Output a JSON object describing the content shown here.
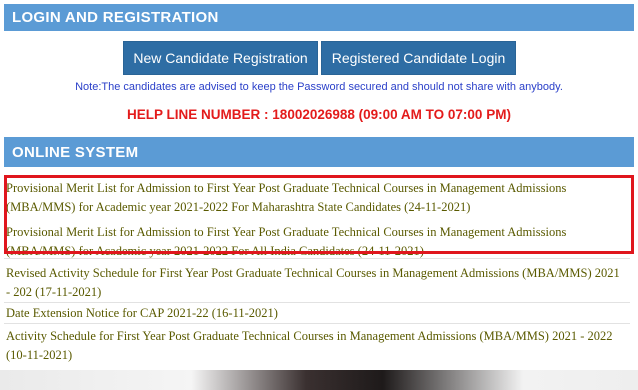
{
  "login_section": {
    "title": "LOGIN AND REGISTRATION",
    "new_registration_label": "New Candidate Registration",
    "registered_login_label": "Registered Candidate Login",
    "note": "Note:The candidates are advised to keep the Password secured and should not share with anybody.",
    "helpline": "HELP LINE NUMBER : 18002026988 (09:00 AM TO 07:00 PM)"
  },
  "online_system": {
    "title": "ONLINE SYSTEM",
    "notices": [
      "Provisional Merit List for Admission to First Year Post Graduate Technical Courses in Management Admissions (MBA/MMS) for Academic year 2021-2022 For Maharashtra State Candidates (24-11-2021)",
      "Provisional Merit List for Admission to First Year Post Graduate Technical Courses in Management Admissions (MBA/MMS) for Academic year 2021-2022 For All India Candidates (24-11-2021)",
      "Revised Activity Schedule for First Year Post Graduate Technical Courses in Management Admissions (MBA/MMS) 2021 - 202 (17-11-2021)",
      "Date Extension Notice for CAP 2021-22 (16-11-2021)",
      "Activity Schedule for First Year Post Graduate Technical Courses in Management Admissions (MBA/MMS) 2021 - 2022 (10-11-2021)"
    ]
  },
  "colors": {
    "header_bg": "#5b9bd5",
    "button_bg": "#2e6da4",
    "note_text": "#2a3fc9",
    "helpline_text": "#e31b1b",
    "notice_text": "#5a5a00",
    "highlight_border": "#e0161d"
  }
}
